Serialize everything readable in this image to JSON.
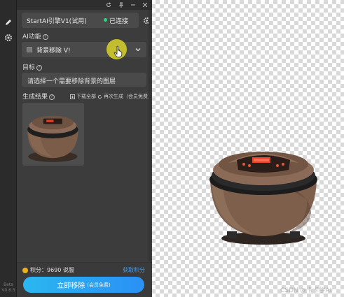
{
  "rail": {
    "version_line1": "Beta",
    "version_line2": "V0.6.5"
  },
  "engine": {
    "name": "StartAI引擎V1(试用)",
    "status": "已连接",
    "status_color": "#33d17a"
  },
  "ai_function": {
    "label": "AI功能",
    "help": "?",
    "selected": "背景移除 V!"
  },
  "target": {
    "label": "目标",
    "help": "?",
    "placeholder": "请选择一个需要移除背景的图层"
  },
  "results": {
    "label": "生成结果",
    "help": "?",
    "download_all": "下载全部",
    "regenerate": "再次生成（会员免费）"
  },
  "footer": {
    "points_text": "积分：9690 说服",
    "get_points": "获取积分",
    "main_button": "立即移除",
    "main_button_sub": "(会员免费)",
    "accent": "#2a90f5"
  },
  "canvas": {
    "watermark": "CSDN @卡卡学AI"
  }
}
